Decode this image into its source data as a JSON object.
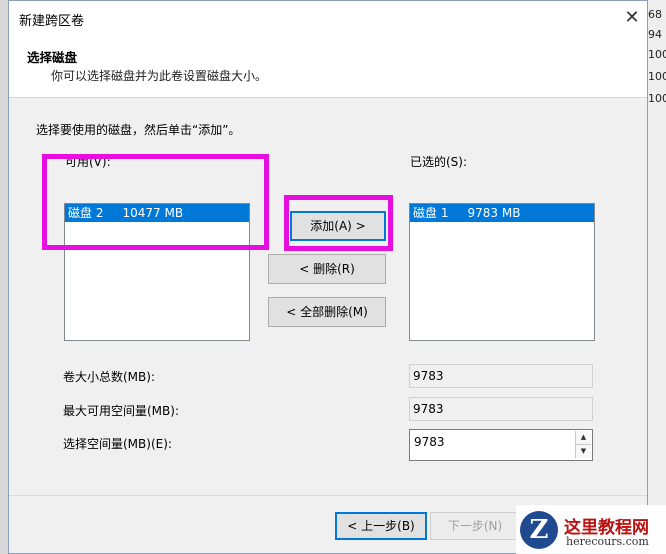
{
  "dialog": {
    "title": "新建跨区卷",
    "close_glyph": "✕",
    "header_title": "选择磁盘",
    "header_subtitle": "你可以选择磁盘并为此卷设置磁盘大小。",
    "instruction": "选择要使用的磁盘，然后单击“添加”。",
    "available_label": "可用(V):",
    "available_items": [
      "磁盘 2     10477 MB"
    ],
    "selected_label": "已选的(S):",
    "selected_items": [
      "磁盘 1     9783 MB"
    ],
    "add_button": "添加(A) >",
    "remove_button": "< 删除(R)",
    "remove_all_button": "< 全部删除(M)",
    "total_label": "卷大小总数(MB):",
    "total_value": "9783",
    "max_label": "最大可用空间量(MB):",
    "max_value": "9783",
    "select_label": "选择空间量(MB)(E):",
    "select_value": "9783",
    "back_button": "< 上一步(B)",
    "next_button": "下一步(N)"
  },
  "background_right": [
    "68",
    "94",
    "100",
    "100",
    "100"
  ],
  "watermark": {
    "logo_letter": "Z",
    "title": "这里教程网",
    "url": "herecours.com"
  },
  "colors": {
    "highlight": "#e60fe0",
    "selection": "#0078d7"
  }
}
